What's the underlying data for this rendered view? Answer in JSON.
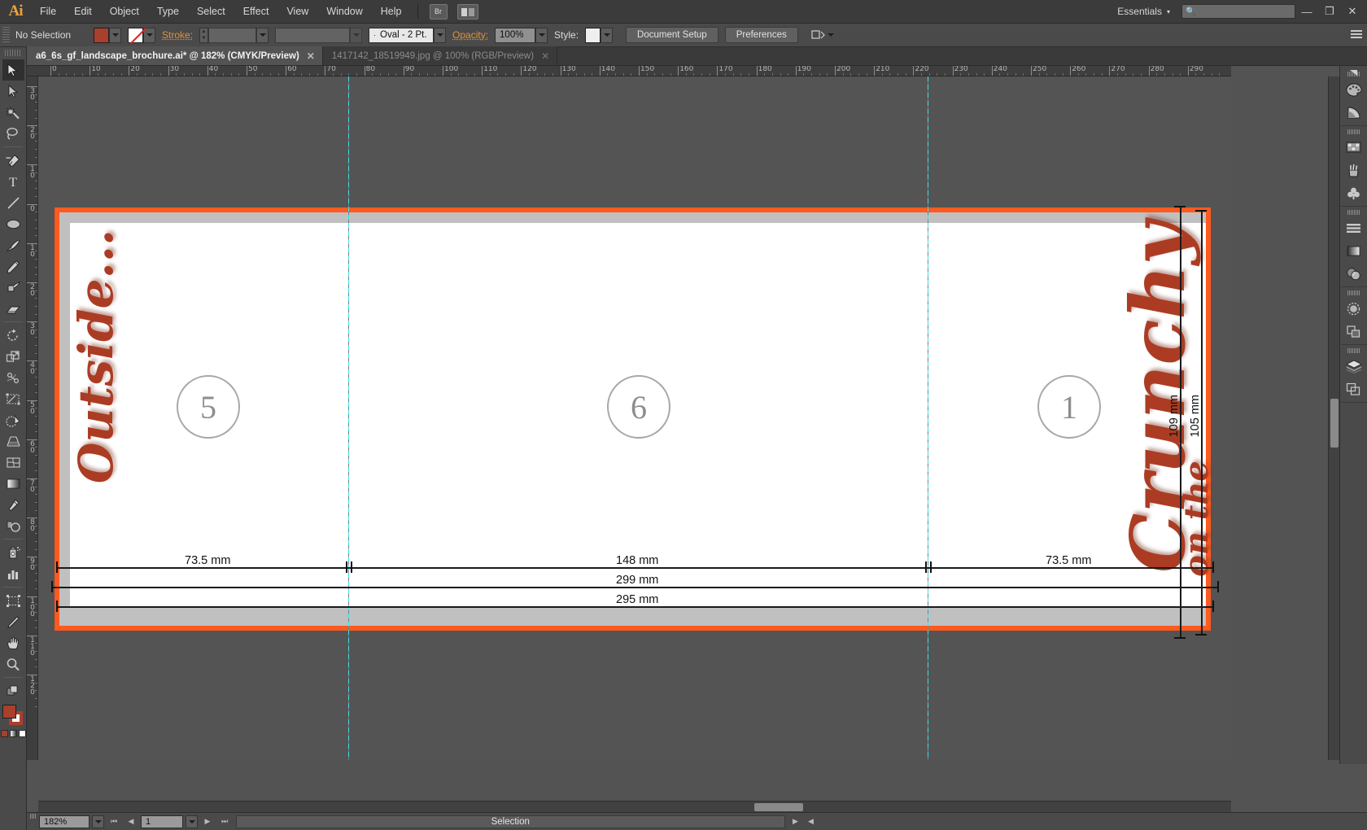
{
  "app": {
    "name": "Ai",
    "workspace": "Essentials",
    "window_controls": [
      "minimize",
      "restore",
      "close"
    ]
  },
  "menubar": {
    "items": [
      "File",
      "Edit",
      "Object",
      "Type",
      "Select",
      "Effect",
      "View",
      "Window",
      "Help"
    ],
    "bridge_label": "Br",
    "search_placeholder": ""
  },
  "controlbar": {
    "selection_status": "No Selection",
    "fill_color": "#a9402c",
    "stroke_label": "Stroke:",
    "stroke_weight": "",
    "stroke_profile": "",
    "brush_definition": "Oval - 2 Pt.",
    "opacity_label": "Opacity:",
    "opacity_value": "100%",
    "style_label": "Style:",
    "document_setup_label": "Document Setup",
    "preferences_label": "Preferences"
  },
  "tabs": [
    {
      "title": "a6_6s_gf_landscape_brochure.ai* @ 182% (CMYK/Preview)",
      "active": true
    },
    {
      "title": "1417142_18519949.jpg @ 100% (RGB/Preview)",
      "active": false
    }
  ],
  "rulers": {
    "horizontal_labels": [
      "0",
      "10",
      "20",
      "30",
      "40",
      "50",
      "60",
      "70",
      "80",
      "90",
      "100",
      "110",
      "120",
      "130",
      "140",
      "150",
      "160",
      "170",
      "180",
      "190",
      "200",
      "210",
      "220",
      "230",
      "240",
      "250",
      "260",
      "270",
      "280",
      "290"
    ],
    "vertical_labels": [
      "30",
      "20",
      "10",
      "0",
      "10",
      "20",
      "30",
      "40",
      "50",
      "60",
      "70",
      "80",
      "90",
      "100",
      "110",
      "120"
    ],
    "unit": "mm"
  },
  "tools": [
    "selection-tool",
    "direct-selection-tool",
    "magic-wand-tool",
    "lasso-tool",
    "pen-tool",
    "type-tool",
    "line-segment-tool",
    "ellipse-tool",
    "paintbrush-tool",
    "pencil-tool",
    "blob-brush-tool",
    "eraser-tool",
    "rotate-tool",
    "scale-tool",
    "width-tool",
    "free-transform-tool",
    "shape-builder-tool",
    "perspective-grid-tool",
    "mesh-tool",
    "gradient-tool",
    "eyedropper-tool",
    "blend-tool",
    "symbol-sprayer-tool",
    "column-graph-tool",
    "artboard-tool",
    "slice-tool",
    "hand-tool",
    "zoom-tool"
  ],
  "dock_panels": [
    "color-panel",
    "color-guide-panel",
    "swatches-panel",
    "brushes-panel",
    "symbols-panel",
    "align-panel",
    "gradient-panel",
    "transparency-panel",
    "appearance-panel",
    "pathfinder-panel",
    "layers-panel",
    "artboards-panel"
  ],
  "artboard": {
    "panels": [
      {
        "number": "5"
      },
      {
        "number": "6"
      },
      {
        "number": "1"
      }
    ],
    "dimensions": {
      "left_panel_width": "73.5 mm",
      "center_panel_width": "148 mm",
      "right_panel_width": "73.5 mm",
      "total_width_trim": "299 mm",
      "total_width_inner": "295 mm",
      "height_bleed": "109 mm",
      "height_trim": "105 mm"
    },
    "artwork": {
      "left_text": "Outside...",
      "right_text_main": "Crunchy",
      "right_text_sub": "on the",
      "text_color": "#ab3c23"
    }
  },
  "statusbar": {
    "zoom_level": "182%",
    "page_number": "1",
    "status_text": "Selection"
  }
}
